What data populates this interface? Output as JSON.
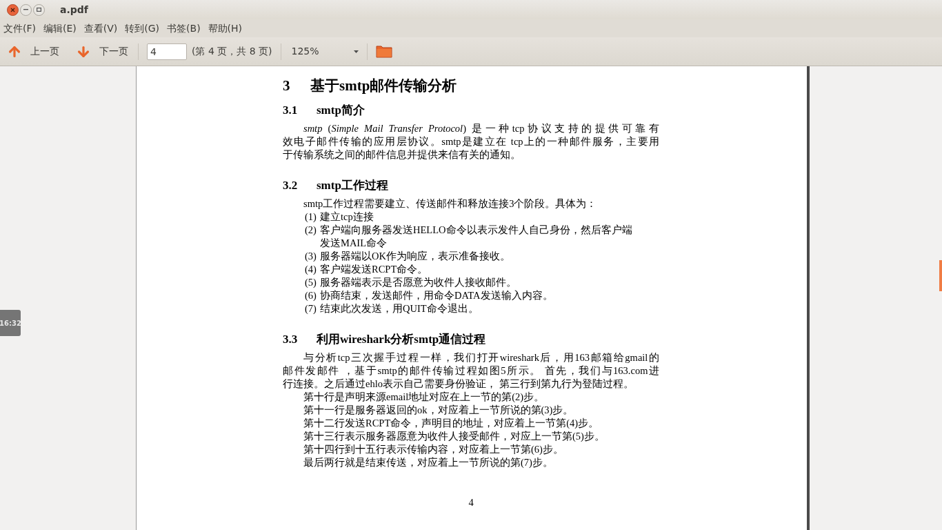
{
  "window": {
    "title": "a.pdf"
  },
  "menu": [
    "文件(F)",
    "编辑(E)",
    "查看(V)",
    "转到(G)",
    "书签(B)",
    "帮助(H)"
  ],
  "toolbar": {
    "prev": "上一页",
    "next": "下一页",
    "page_value": "4",
    "page_info": "(第 4 页，共 8 页)",
    "zoom": "125%"
  },
  "clock": "16:32",
  "document": {
    "heading": {
      "number": "3",
      "title": "基于smtp邮件传输分析"
    },
    "sections": [
      {
        "number": "3.1",
        "title": "smtp简介",
        "blocks": [
          {
            "kind": "paragraph",
            "lines": [
              "*smtp* (*Simple Mail Transfer Protocol*) 是一种tcp协议支持的提供可靠有",
              "效电子邮件传输的应用层协议。smtp是建立在 tcp上的一种邮件服务，主要用",
              "于传输系统之间的邮件信息并提供来信有关的通知。"
            ]
          }
        ]
      },
      {
        "number": "3.2",
        "title": "smtp工作过程",
        "blocks": [
          {
            "kind": "paragraph",
            "lines": [
              "smtp工作过程需要建立、传送邮件和释放连接3个阶段。具体为："
            ]
          },
          {
            "kind": "item",
            "label": "(1)",
            "lines": [
              "建立tcp连接"
            ]
          },
          {
            "kind": "item",
            "label": "(2)",
            "lines": [
              "客户端向服务器发送HELLO命令以表示发件人自己身份，然后客户端",
              "发送MAIL命令"
            ]
          },
          {
            "kind": "item",
            "label": "(3)",
            "lines": [
              "服务器端以OK作为响应，表示准备接收。"
            ]
          },
          {
            "kind": "item",
            "label": "(4)",
            "lines": [
              "客户端发送RCPT命令。"
            ]
          },
          {
            "kind": "item",
            "label": "(5)",
            "lines": [
              "服务器端表示是否愿意为收件人接收邮件。"
            ]
          },
          {
            "kind": "item",
            "label": "(6)",
            "lines": [
              "协商结束，发送邮件，用命令DATA发送输入内容。"
            ]
          },
          {
            "kind": "item",
            "label": "(7)",
            "lines": [
              "结束此次发送，用QUIT命令退出。"
            ]
          }
        ]
      },
      {
        "number": "3.3",
        "title": "利用wireshark分析smtp通信过程",
        "blocks": [
          {
            "kind": "paragraph",
            "lines": [
              "与分析tcp三次握手过程一样，我们打开wireshark后，用163邮箱给gmail的",
              "邮件发邮件 ，基于smtp的邮件传输过程如图5所示。 首先，我们与163.com进",
              "行连接。之后通过ehlo表示自己需要身份验证， 第三行到第九行为登陆过程。"
            ]
          },
          {
            "kind": "paragraph",
            "lines": [
              "第十行是声明来源email地址对应在上一节的第(2)步。"
            ]
          },
          {
            "kind": "paragraph",
            "lines": [
              "第十一行是服务器返回的ok，对应着上一节所说的第(3)步。"
            ]
          },
          {
            "kind": "paragraph",
            "lines": [
              "第十二行发送RCPT命令，声明目的地址，对应着上一节第(4)步。"
            ]
          },
          {
            "kind": "paragraph",
            "lines": [
              "第十三行表示服务器愿意为收件人接受邮件，对应上一节第(5)步。"
            ]
          },
          {
            "kind": "paragraph",
            "lines": [
              "第十四行到十五行表示传输内容，对应着上一节第(6)步。"
            ]
          },
          {
            "kind": "paragraph",
            "lines": [
              "最后两行就是结束传送，对应着上一节所说的第(7)步。"
            ]
          }
        ]
      }
    ],
    "page_number": "4"
  }
}
